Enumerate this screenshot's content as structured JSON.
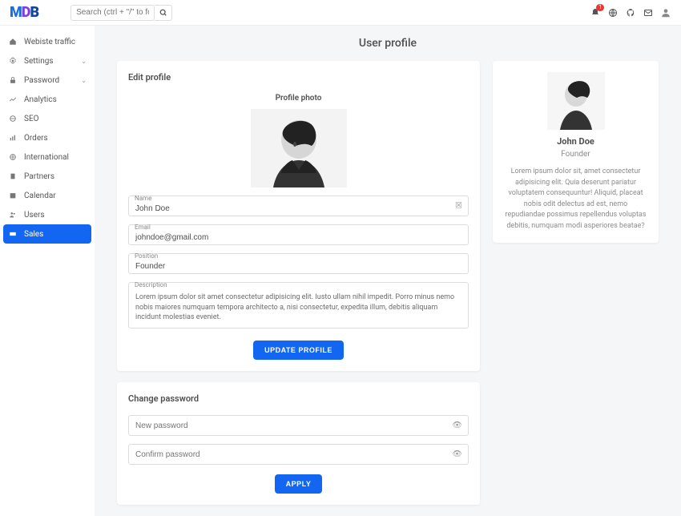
{
  "logo": {
    "m": "M",
    "d": "D",
    "b": "B"
  },
  "search": {
    "placeholder": "Search (ctrl + \"/\" to focus)"
  },
  "header": {
    "bell_badge": "1"
  },
  "sidebar": {
    "items": [
      {
        "label": "Webiste traffic"
      },
      {
        "label": "Settings"
      },
      {
        "label": "Password"
      },
      {
        "label": "Analytics"
      },
      {
        "label": "SEO"
      },
      {
        "label": "Orders"
      },
      {
        "label": "International"
      },
      {
        "label": "Partners"
      },
      {
        "label": "Calendar"
      },
      {
        "label": "Users"
      },
      {
        "label": "Sales"
      }
    ]
  },
  "page": {
    "title": "User profile"
  },
  "edit": {
    "title": "Edit profile",
    "photo_label": "Profile photo",
    "name_label": "Name",
    "name_value": "John Doe",
    "email_label": "Email",
    "email_value": "johndoe@gmail.com",
    "position_label": "Position",
    "position_value": "Founder",
    "desc_label": "Description",
    "desc_value": "Lorem ipsum dolor sit amet consectetur adipisicing elit. Iusto ullam nihil impedit. Porro minus nemo nobis maiores numquam tempora architecto a, nisi consectetur, expedita illum, debitis aliquam incidunt molestias eveniet.",
    "button": "UPDATE PROFILE"
  },
  "profile": {
    "name": "John Doe",
    "role": "Founder",
    "bio": "Lorem ipsum dolor sit, amet consectetur adipisicing elit. Quia deserunt pariatur voluptatem consequuntur! Aliquid, placeat nobis odit delectus ad est, nemo repudiandae possimus repellendus voluptas debitis, numquam modi asperiores beatae?"
  },
  "password": {
    "title": "Change password",
    "new_label": "New password",
    "confirm_label": "Confirm password",
    "button": "APPLY"
  }
}
